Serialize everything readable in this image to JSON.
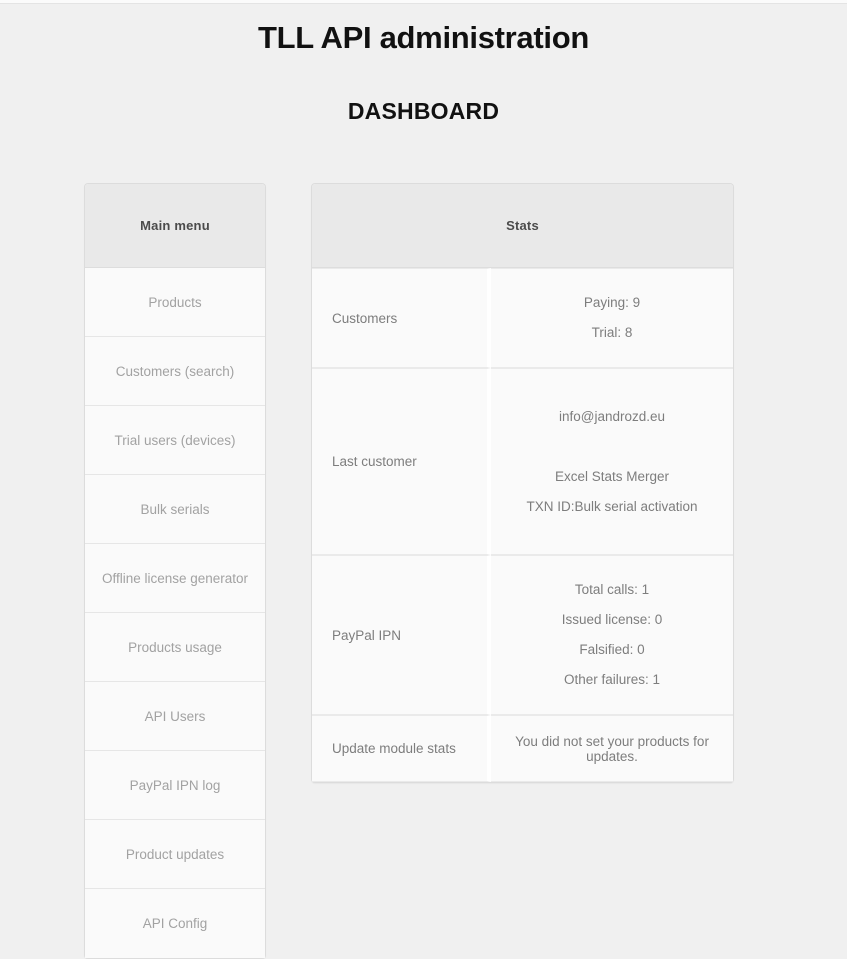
{
  "header": {
    "title": "TLL API administration",
    "subtitle": "DASHBOARD"
  },
  "sidebar": {
    "heading": "Main menu",
    "items": [
      {
        "label": "Products"
      },
      {
        "label": "Customers (search)"
      },
      {
        "label": "Trial users (devices)"
      },
      {
        "label": "Bulk serials"
      },
      {
        "label": "Offline license generator"
      },
      {
        "label": "Products usage"
      },
      {
        "label": "API Users"
      },
      {
        "label": "PayPal IPN log"
      },
      {
        "label": "Product updates"
      },
      {
        "label": "API Config"
      }
    ]
  },
  "stats": {
    "heading": "Stats",
    "rows": {
      "customers": {
        "label": "Customers",
        "paying": "Paying: 9",
        "trial": "Trial: 8"
      },
      "last_customer": {
        "label": "Last customer",
        "email": "info@jandrozd.eu",
        "product": "Excel Stats Merger",
        "txn": "TXN ID:Bulk serial activation"
      },
      "paypal_ipn": {
        "label": "PayPal IPN",
        "total_calls": "Total calls: 1",
        "issued_license": "Issued license: 0",
        "falsified": "Falsified: 0",
        "other_failures": "Other failures: 1"
      },
      "update_module": {
        "label": "Update module stats",
        "message": "You did not set your products for updates."
      }
    }
  },
  "colors": {
    "page_background": "#f0f0f0",
    "panel_heading_background": "#e9e9e9",
    "panel_background": "#fafafa",
    "border": "#dcdcdc",
    "menu_text": "#a2a2a2",
    "stats_text": "#7d7d7d",
    "title_text": "#111111"
  }
}
